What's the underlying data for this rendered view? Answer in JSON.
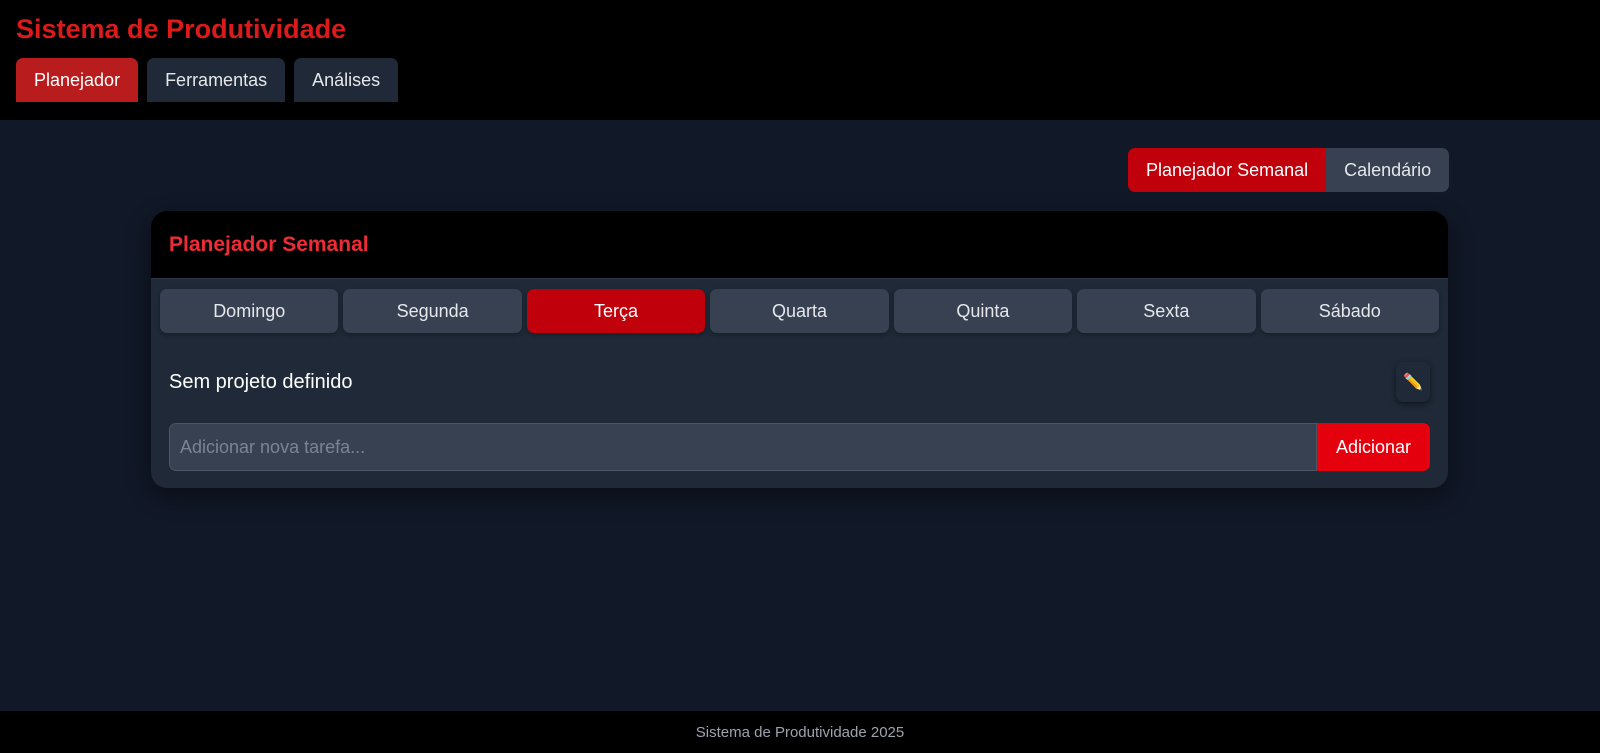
{
  "header": {
    "title": "Sistema de Produtividade",
    "tabs": [
      {
        "label": "Planejador",
        "active": true
      },
      {
        "label": "Ferramentas",
        "active": false
      },
      {
        "label": "Análises",
        "active": false
      }
    ]
  },
  "view_toggle": {
    "weekly_label": "Planejador Semanal",
    "calendar_label": "Calendário",
    "active": "weekly"
  },
  "planner": {
    "title": "Planejador Semanal",
    "days": [
      "Domingo",
      "Segunda",
      "Terça",
      "Quarta",
      "Quinta",
      "Sexta",
      "Sábado"
    ],
    "active_day": "Terça",
    "project_label": "Sem projeto definido",
    "edit_icon": "pencil-icon",
    "task_input": {
      "value": "",
      "placeholder": "Adicionar nova tarefa..."
    },
    "add_label": "Adicionar"
  },
  "footer": {
    "text": "Sistema de Produtividade 2025"
  },
  "colors": {
    "accent": "#c0000a",
    "title_red": "#dc1a1a",
    "background": "#111827",
    "card": "#1f2937"
  }
}
